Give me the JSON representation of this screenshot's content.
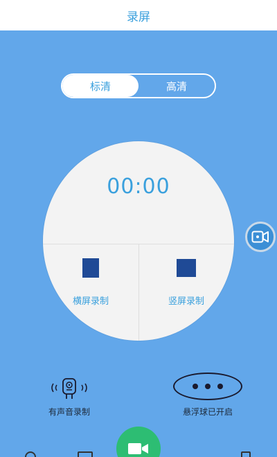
{
  "header": {
    "title": "录屏"
  },
  "quality": {
    "options": [
      "标清",
      "高清"
    ],
    "selected": "标清"
  },
  "timer": {
    "value": "00:00"
  },
  "record_modes": {
    "landscape_label": "横屏录制",
    "portrait_label": "竖屏录制"
  },
  "actions": {
    "audio_label": "有声音录制",
    "float_ball_label": "悬浮球已开启"
  },
  "colors": {
    "accent": "#3aa0dd",
    "background": "#62a7ea",
    "record": "#2dbd73",
    "dial": "#f3f3f3",
    "screen_icon": "#1f4a96"
  },
  "icons": {
    "float_cam": "video-camera-icon",
    "audio": "microphone-icon",
    "float_ball": "more-dots-icon",
    "record": "video-record-icon"
  }
}
